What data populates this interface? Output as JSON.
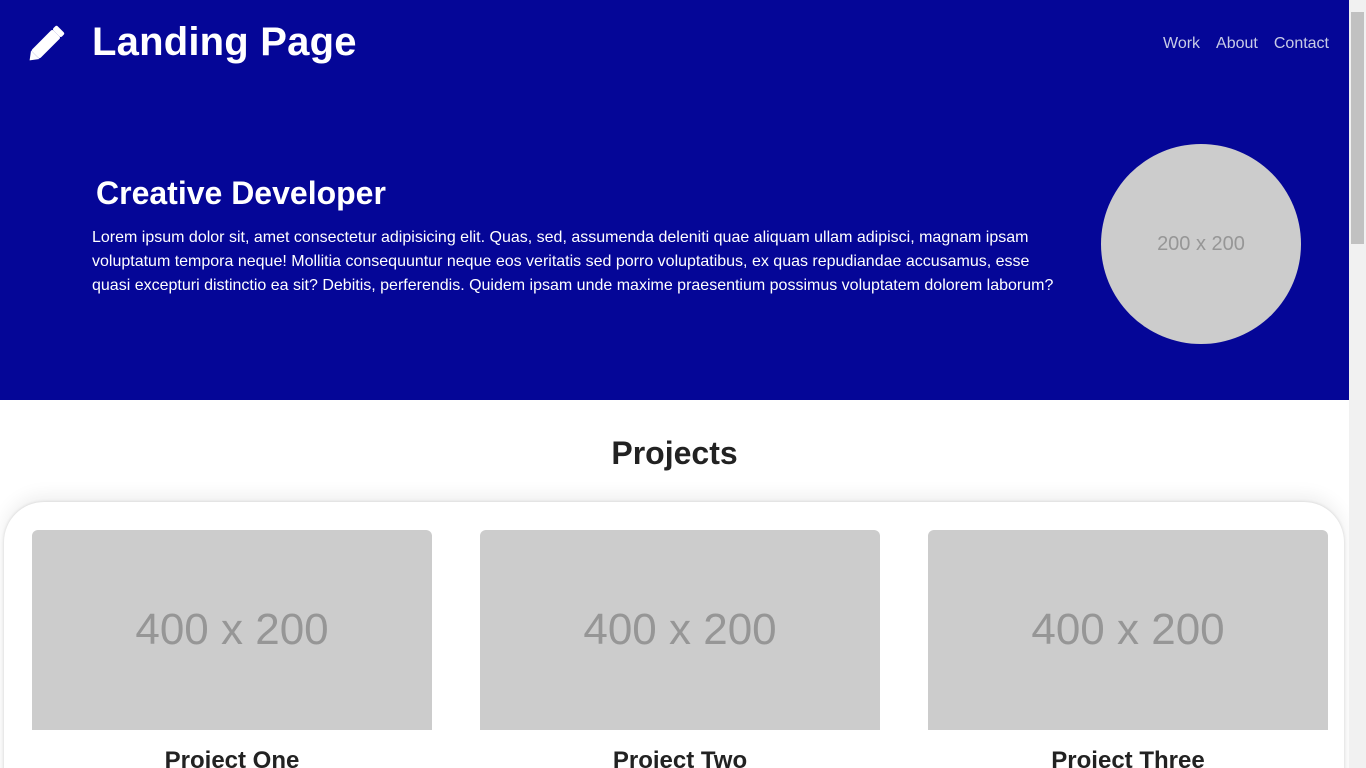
{
  "header": {
    "brand_title": "Landing Page",
    "brand_icon": "pencil-icon",
    "nav": [
      "Work",
      "About",
      "Contact"
    ]
  },
  "hero": {
    "heading": "Creative Developer",
    "text": "Lorem ipsum dolor sit, amet consectetur adipisicing elit. Quas, sed, assumenda deleniti quae aliquam ullam adipisci, magnam ipsam voluptatum tempora neque! Mollitia consequuntur neque eos veritatis sed porro voluptatibus, ex quas repudiandae accusamus, esse quasi excepturi distinctio ea sit? Debitis, perferendis. Quidem ipsam unde maxime praesentium possimus voluptatem dolorem laborum?",
    "avatar_placeholder": "200 x 200"
  },
  "projects": {
    "title": "Projects",
    "items": [
      {
        "image_placeholder": "400 x 200",
        "name": "Project One"
      },
      {
        "image_placeholder": "400 x 200",
        "name": "Project Two"
      },
      {
        "image_placeholder": "400 x 200",
        "name": "Project Three"
      }
    ]
  },
  "colors": {
    "hero_background": "#050697",
    "placeholder_background": "#cccccc",
    "placeholder_text": "#969696"
  }
}
